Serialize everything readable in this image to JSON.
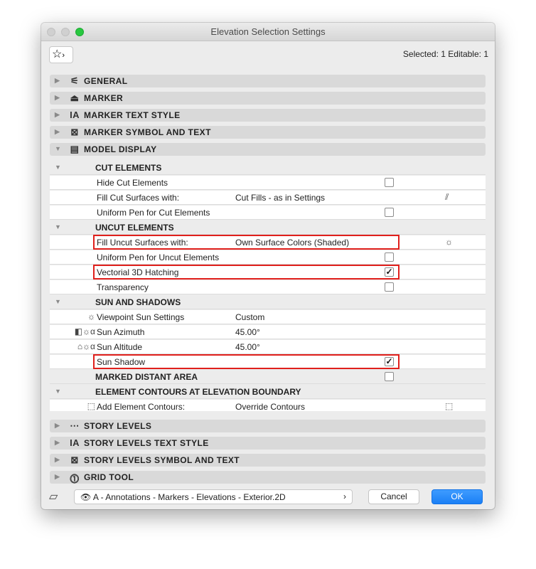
{
  "window": {
    "title": "Elevation Selection Settings"
  },
  "header": {
    "favorites_icon": "star-icon",
    "selection_info": "Selected: 1 Editable: 1"
  },
  "top_sections": [
    {
      "label": "GENERAL",
      "icon": "general-icon",
      "expanded": false
    },
    {
      "label": "MARKER",
      "icon": "marker-icon",
      "expanded": false
    },
    {
      "label": "MARKER TEXT STYLE",
      "icon": "text-style-icon",
      "expanded": false
    },
    {
      "label": "MARKER SYMBOL AND TEXT",
      "icon": "symbol-text-icon",
      "expanded": false
    },
    {
      "label": "MODEL DISPLAY",
      "icon": "model-display-icon",
      "expanded": true
    }
  ],
  "model_display": {
    "cut_elements": {
      "title": "CUT ELEMENTS",
      "rows": [
        {
          "label": "Hide Cut Elements",
          "checked": false
        },
        {
          "label": "Fill Cut Surfaces with:",
          "value": "Cut Fills - as in Settings"
        },
        {
          "label": "Uniform Pen for Cut Elements",
          "checked": false
        }
      ]
    },
    "uncut_elements": {
      "title": "UNCUT ELEMENTS",
      "rows": [
        {
          "label": "Fill Uncut Surfaces with:",
          "value": "Own Surface Colors (Shaded)"
        },
        {
          "label": "Uniform Pen for Uncut Elements",
          "checked": false
        },
        {
          "label": "Vectorial 3D Hatching",
          "checked": true
        },
        {
          "label": "Transparency",
          "checked": false
        }
      ]
    },
    "sun_and_shadows": {
      "title": "SUN AND SHADOWS",
      "rows": [
        {
          "label": "Viewpoint Sun Settings",
          "value": "Custom"
        },
        {
          "label": "Sun Azimuth",
          "value": "45.00°"
        },
        {
          "label": "Sun Altitude",
          "value": "45.00°"
        },
        {
          "label": "Sun Shadow",
          "checked": true
        }
      ]
    },
    "marked_distant_area": {
      "title": "MARKED DISTANT AREA",
      "checked": false
    },
    "element_contours": {
      "title": "ELEMENT CONTOURS AT ELEVATION BOUNDARY",
      "rows": [
        {
          "label": "Add Element Contours:",
          "value": "Override Contours"
        }
      ]
    }
  },
  "bottom_sections": [
    {
      "label": "STORY LEVELS"
    },
    {
      "label": "STORY LEVELS TEXT STYLE"
    },
    {
      "label": "STORY LEVELS SYMBOL AND TEXT"
    },
    {
      "label": "GRID TOOL"
    }
  ],
  "footer": {
    "layer": "A - Annotations - Markers - Elevations - Exterior.2D",
    "cancel": "Cancel",
    "ok": "OK"
  },
  "colors": {
    "highlight": "#e0201c",
    "ok_button": "#1a7ff5",
    "zoom_light": "#28c840"
  }
}
